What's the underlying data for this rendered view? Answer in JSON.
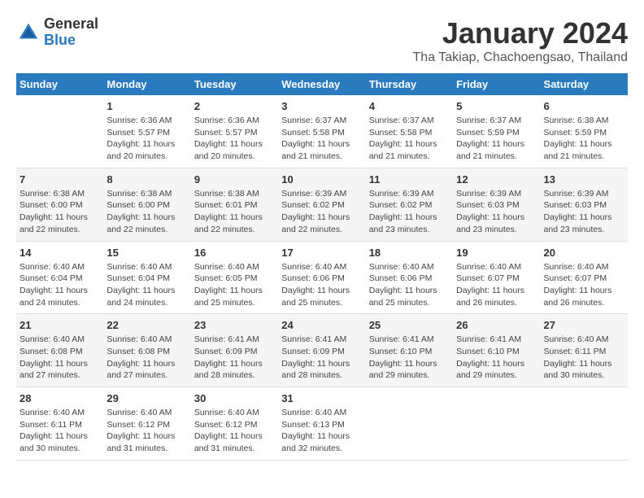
{
  "logo": {
    "general": "General",
    "blue": "Blue"
  },
  "title": "January 2024",
  "subtitle": "Tha Takiap, Chachoengsao, Thailand",
  "days_of_week": [
    "Sunday",
    "Monday",
    "Tuesday",
    "Wednesday",
    "Thursday",
    "Friday",
    "Saturday"
  ],
  "weeks": [
    [
      {
        "num": "",
        "detail": ""
      },
      {
        "num": "1",
        "detail": "Sunrise: 6:36 AM\nSunset: 5:57 PM\nDaylight: 11 hours\nand 20 minutes."
      },
      {
        "num": "2",
        "detail": "Sunrise: 6:36 AM\nSunset: 5:57 PM\nDaylight: 11 hours\nand 20 minutes."
      },
      {
        "num": "3",
        "detail": "Sunrise: 6:37 AM\nSunset: 5:58 PM\nDaylight: 11 hours\nand 21 minutes."
      },
      {
        "num": "4",
        "detail": "Sunrise: 6:37 AM\nSunset: 5:58 PM\nDaylight: 11 hours\nand 21 minutes."
      },
      {
        "num": "5",
        "detail": "Sunrise: 6:37 AM\nSunset: 5:59 PM\nDaylight: 11 hours\nand 21 minutes."
      },
      {
        "num": "6",
        "detail": "Sunrise: 6:38 AM\nSunset: 5:59 PM\nDaylight: 11 hours\nand 21 minutes."
      }
    ],
    [
      {
        "num": "7",
        "detail": "Sunrise: 6:38 AM\nSunset: 6:00 PM\nDaylight: 11 hours\nand 22 minutes."
      },
      {
        "num": "8",
        "detail": "Sunrise: 6:38 AM\nSunset: 6:00 PM\nDaylight: 11 hours\nand 22 minutes."
      },
      {
        "num": "9",
        "detail": "Sunrise: 6:38 AM\nSunset: 6:01 PM\nDaylight: 11 hours\nand 22 minutes."
      },
      {
        "num": "10",
        "detail": "Sunrise: 6:39 AM\nSunset: 6:02 PM\nDaylight: 11 hours\nand 22 minutes."
      },
      {
        "num": "11",
        "detail": "Sunrise: 6:39 AM\nSunset: 6:02 PM\nDaylight: 11 hours\nand 23 minutes."
      },
      {
        "num": "12",
        "detail": "Sunrise: 6:39 AM\nSunset: 6:03 PM\nDaylight: 11 hours\nand 23 minutes."
      },
      {
        "num": "13",
        "detail": "Sunrise: 6:39 AM\nSunset: 6:03 PM\nDaylight: 11 hours\nand 23 minutes."
      }
    ],
    [
      {
        "num": "14",
        "detail": "Sunrise: 6:40 AM\nSunset: 6:04 PM\nDaylight: 11 hours\nand 24 minutes."
      },
      {
        "num": "15",
        "detail": "Sunrise: 6:40 AM\nSunset: 6:04 PM\nDaylight: 11 hours\nand 24 minutes."
      },
      {
        "num": "16",
        "detail": "Sunrise: 6:40 AM\nSunset: 6:05 PM\nDaylight: 11 hours\nand 25 minutes."
      },
      {
        "num": "17",
        "detail": "Sunrise: 6:40 AM\nSunset: 6:06 PM\nDaylight: 11 hours\nand 25 minutes."
      },
      {
        "num": "18",
        "detail": "Sunrise: 6:40 AM\nSunset: 6:06 PM\nDaylight: 11 hours\nand 25 minutes."
      },
      {
        "num": "19",
        "detail": "Sunrise: 6:40 AM\nSunset: 6:07 PM\nDaylight: 11 hours\nand 26 minutes."
      },
      {
        "num": "20",
        "detail": "Sunrise: 6:40 AM\nSunset: 6:07 PM\nDaylight: 11 hours\nand 26 minutes."
      }
    ],
    [
      {
        "num": "21",
        "detail": "Sunrise: 6:40 AM\nSunset: 6:08 PM\nDaylight: 11 hours\nand 27 minutes."
      },
      {
        "num": "22",
        "detail": "Sunrise: 6:40 AM\nSunset: 6:08 PM\nDaylight: 11 hours\nand 27 minutes."
      },
      {
        "num": "23",
        "detail": "Sunrise: 6:41 AM\nSunset: 6:09 PM\nDaylight: 11 hours\nand 28 minutes."
      },
      {
        "num": "24",
        "detail": "Sunrise: 6:41 AM\nSunset: 6:09 PM\nDaylight: 11 hours\nand 28 minutes."
      },
      {
        "num": "25",
        "detail": "Sunrise: 6:41 AM\nSunset: 6:10 PM\nDaylight: 11 hours\nand 29 minutes."
      },
      {
        "num": "26",
        "detail": "Sunrise: 6:41 AM\nSunset: 6:10 PM\nDaylight: 11 hours\nand 29 minutes."
      },
      {
        "num": "27",
        "detail": "Sunrise: 6:40 AM\nSunset: 6:11 PM\nDaylight: 11 hours\nand 30 minutes."
      }
    ],
    [
      {
        "num": "28",
        "detail": "Sunrise: 6:40 AM\nSunset: 6:11 PM\nDaylight: 11 hours\nand 30 minutes."
      },
      {
        "num": "29",
        "detail": "Sunrise: 6:40 AM\nSunset: 6:12 PM\nDaylight: 11 hours\nand 31 minutes."
      },
      {
        "num": "30",
        "detail": "Sunrise: 6:40 AM\nSunset: 6:12 PM\nDaylight: 11 hours\nand 31 minutes."
      },
      {
        "num": "31",
        "detail": "Sunrise: 6:40 AM\nSunset: 6:13 PM\nDaylight: 11 hours\nand 32 minutes."
      },
      {
        "num": "",
        "detail": ""
      },
      {
        "num": "",
        "detail": ""
      },
      {
        "num": "",
        "detail": ""
      }
    ]
  ]
}
